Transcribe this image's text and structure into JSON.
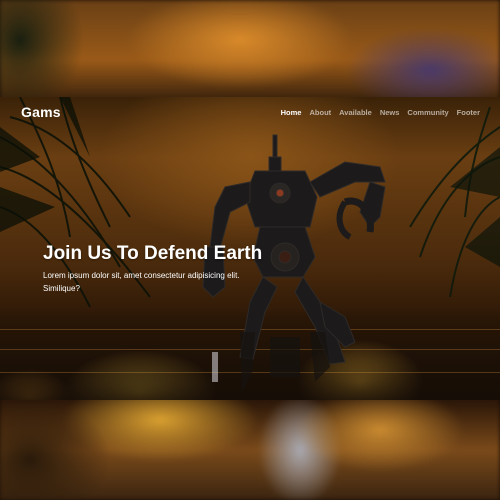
{
  "site": {
    "brand": "Gams"
  },
  "nav": {
    "items": [
      {
        "label": "Home",
        "active": true
      },
      {
        "label": "About",
        "active": false
      },
      {
        "label": "Available",
        "active": false
      },
      {
        "label": "News",
        "active": false
      },
      {
        "label": "Community",
        "active": false
      },
      {
        "label": "Footer",
        "active": false
      }
    ]
  },
  "hero": {
    "headline": "Join Us To Defend Earth",
    "subtext": "Lorem ipsum dolor sit, amet consectetur adipisicing elit. Similique?",
    "image": "robot-mech-in-flooded-jungle"
  },
  "colors": {
    "brand_text": "#ffffff",
    "nav_active": "#ffffff",
    "nav_inactive": "#bfbfbf",
    "fire_glow": "#f0c040"
  }
}
